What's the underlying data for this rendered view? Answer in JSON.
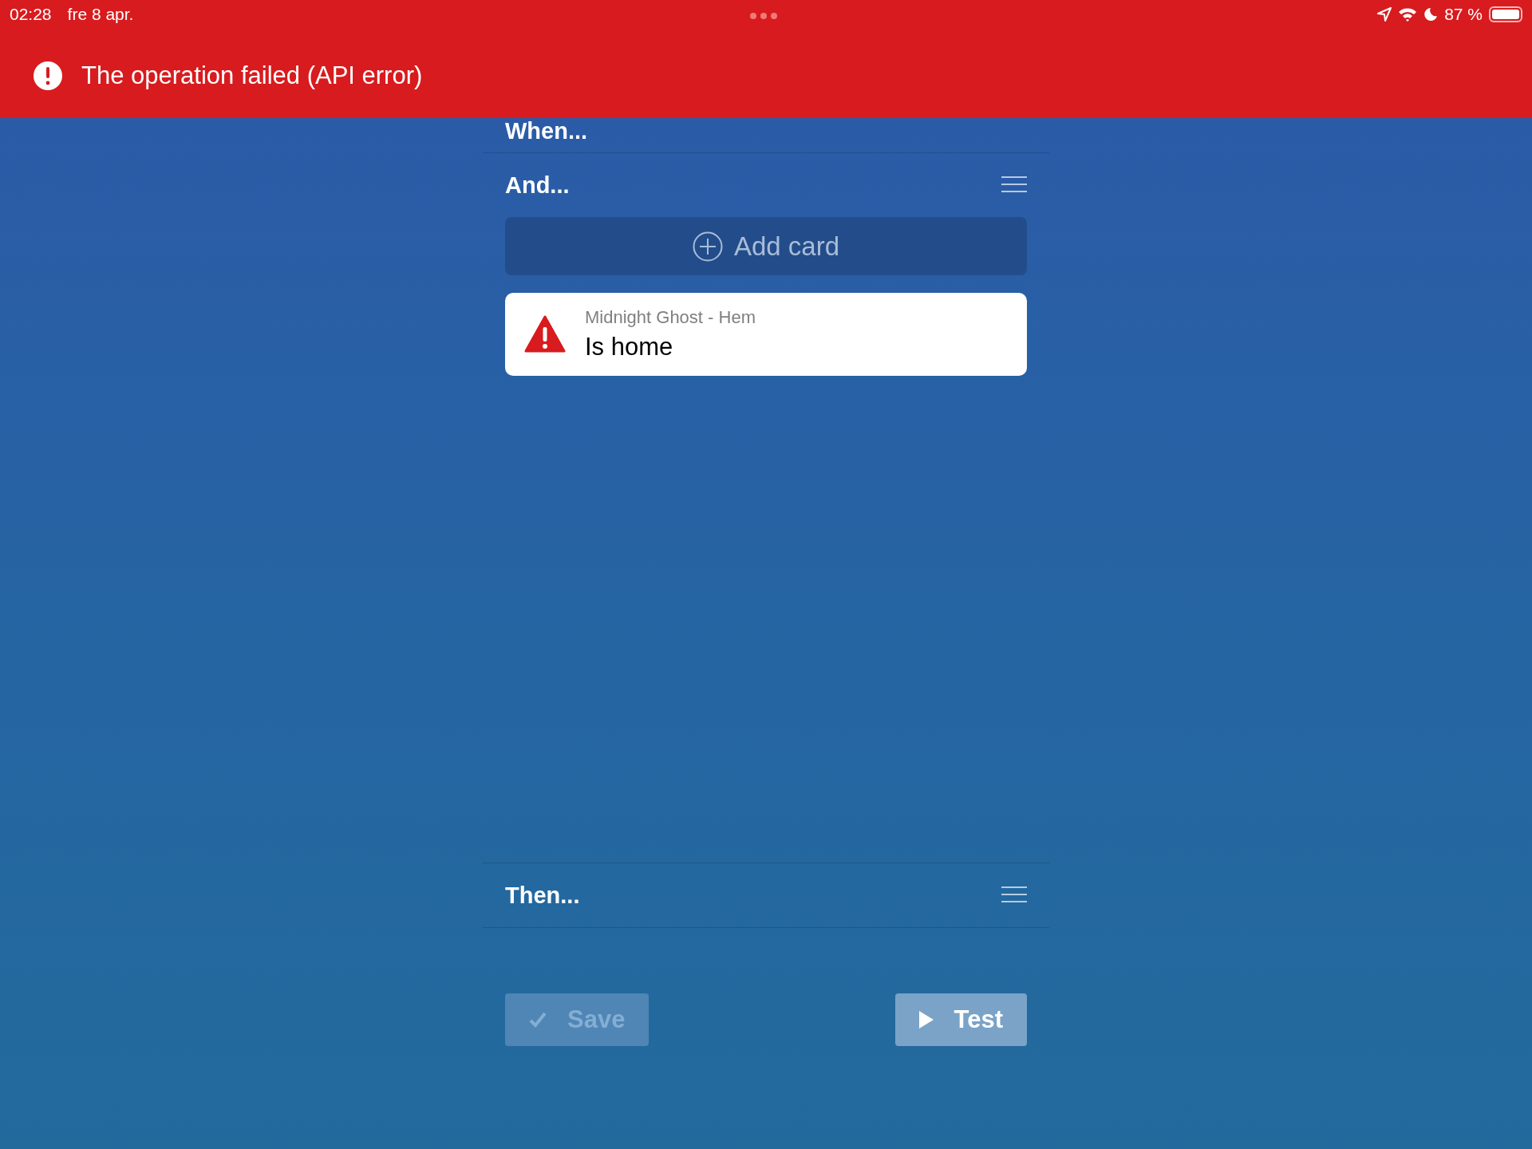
{
  "status_bar": {
    "time": "02:28",
    "date": "fre 8 apr.",
    "battery": "87 %"
  },
  "banner": {
    "message": "The operation failed (API error)"
  },
  "sections": [
    {
      "title": "When..."
    },
    {
      "title": "And...",
      "add_button": "Add card",
      "cards": [
        {
          "device": "Midnight Ghost - Hem",
          "condition": "Is home",
          "error": true
        }
      ]
    },
    {
      "title": "Then..."
    }
  ],
  "buttons": [
    {
      "kind": "save",
      "label": "Save",
      "disabled": true
    },
    {
      "kind": "test",
      "label": "Test",
      "disabled": false
    }
  ]
}
